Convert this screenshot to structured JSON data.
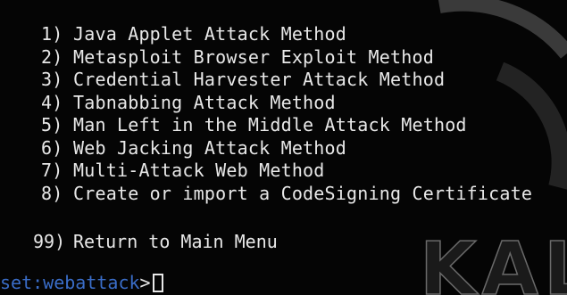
{
  "menu": {
    "items": [
      {
        "number": "1)",
        "label": "Java Applet Attack Method"
      },
      {
        "number": "2)",
        "label": "Metasploit Browser Exploit Method"
      },
      {
        "number": "3)",
        "label": "Credential Harvester Attack Method"
      },
      {
        "number": "4)",
        "label": "Tabnabbing Attack Method"
      },
      {
        "number": "5)",
        "label": "Man Left in the Middle Attack Method"
      },
      {
        "number": "6)",
        "label": "Web Jacking Attack Method"
      },
      {
        "number": "7)",
        "label": "Multi-Attack Web Method"
      },
      {
        "number": "8)",
        "label": "Create or import a CodeSigning Certificate"
      }
    ],
    "return": {
      "number": "99)",
      "label": "Return to Main Menu"
    }
  },
  "prompt": {
    "prefix": "set",
    "separator": ":",
    "module": "webattack",
    "caret": ">"
  },
  "watermark": {
    "logo_text": "KALI"
  },
  "colors": {
    "background": "#050505",
    "text": "#e8e8e8",
    "prompt_accent": "#3a6dc8"
  }
}
